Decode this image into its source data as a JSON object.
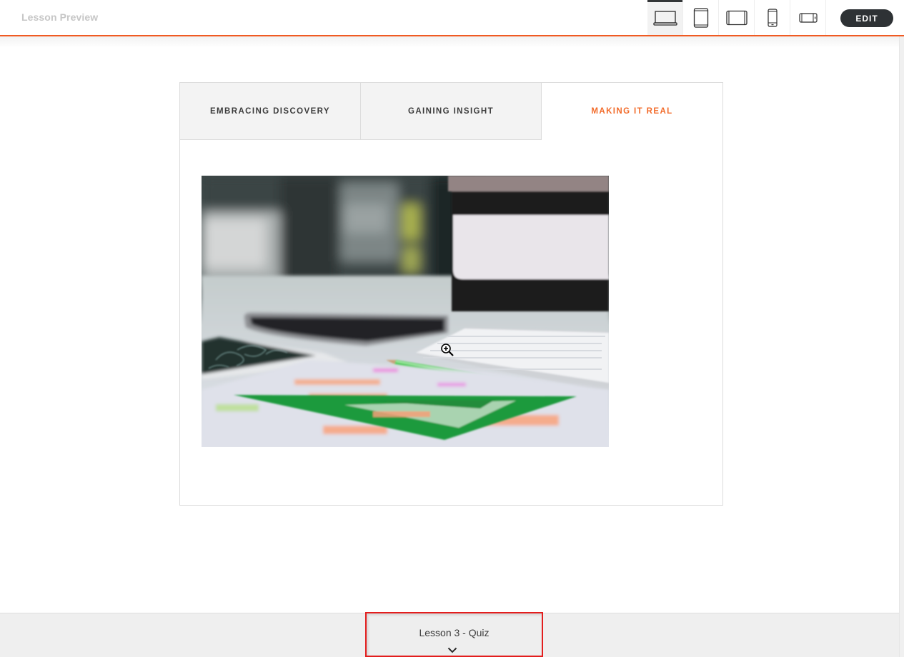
{
  "header": {
    "title": "Lesson Preview",
    "devices": [
      {
        "name": "desktop-view",
        "icon": "laptop-icon",
        "active": true
      },
      {
        "name": "tablet-portrait-view",
        "icon": "tablet-portrait-icon",
        "active": false
      },
      {
        "name": "tablet-landscape-view",
        "icon": "tablet-landscape-icon",
        "active": false
      },
      {
        "name": "phone-portrait-view",
        "icon": "phone-portrait-icon",
        "active": false
      },
      {
        "name": "phone-landscape-view",
        "icon": "phone-landscape-icon",
        "active": false
      }
    ],
    "edit_label": "EDIT"
  },
  "tabs": {
    "items": [
      {
        "label": "EMBRACING DISCOVERY",
        "active": false
      },
      {
        "label": "GAINING INSIGHT",
        "active": false
      },
      {
        "label": "MAKING IT REAL",
        "active": true
      }
    ],
    "active_color": "#f26b2a"
  },
  "content": {
    "image_alt": "Blurred desk with tablet, keyboard, green pencil, and a green set square on printed charts",
    "cursor": "zoom-in-cursor-icon"
  },
  "footer": {
    "next_lesson_label": "Lesson 3 - Quiz",
    "next_icon": "chevron-down-icon"
  },
  "colors": {
    "accent": "#f05a22",
    "edit_button": "#2e3235",
    "highlight_box": "#e31d1d"
  }
}
